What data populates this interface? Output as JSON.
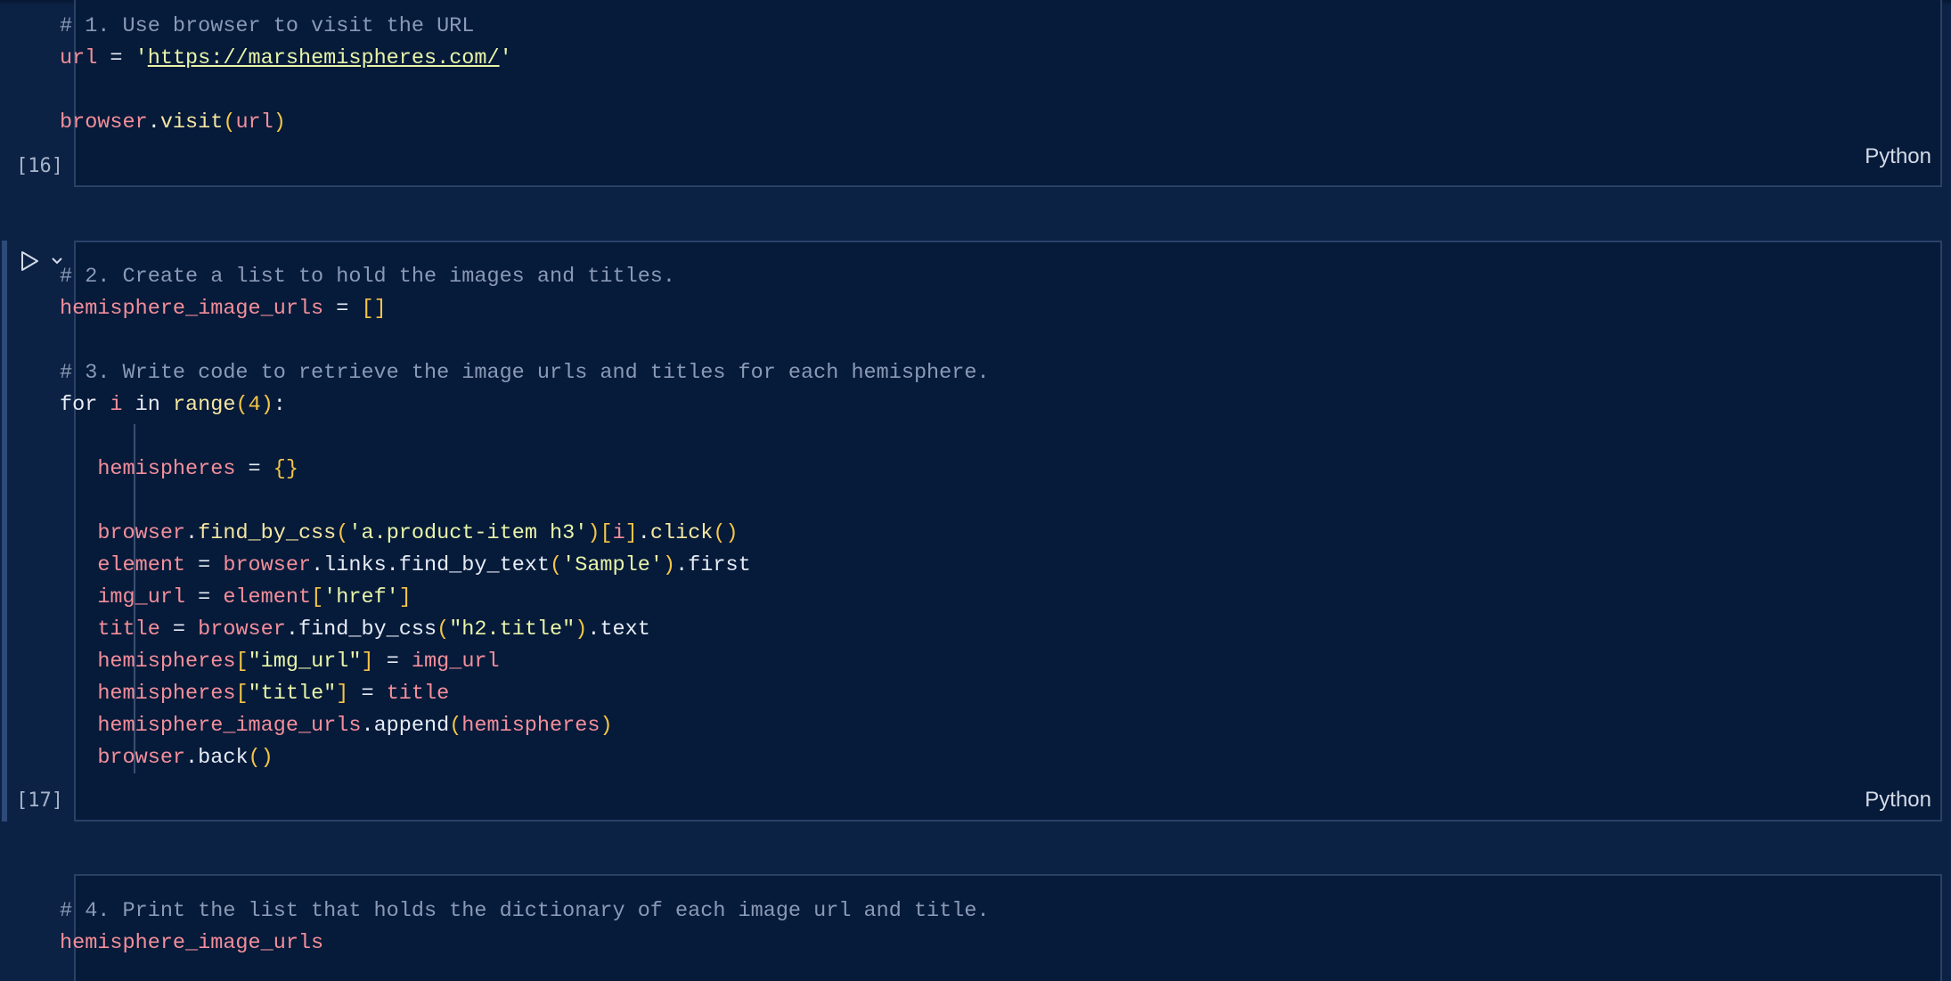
{
  "cells": [
    {
      "exec_count": "[16]",
      "language": "Python",
      "lines": {
        "l1": "# 1. Use browser to visit the URL",
        "l2_var": "url",
        "l2_eq": " = ",
        "l2_q1": "'",
        "l2_url": "https://marshemispheres.com/",
        "l2_q2": "'",
        "l4_obj": "browser",
        "l4_dot": ".",
        "l4_fn": "visit",
        "l4_open": "(",
        "l4_arg": "url",
        "l4_close": ")"
      }
    },
    {
      "exec_count": "[17]",
      "language": "Python",
      "lines": {
        "l1": "# 2. Create a list to hold the images and titles.",
        "l2_var": "hemisphere_image_urls",
        "l2_eq": " = ",
        "l2_br": "[]",
        "l4": "# 3. Write code to retrieve the image urls and titles for each hemisphere.",
        "l5_for": "for ",
        "l5_i": "i",
        "l5_in": " in ",
        "l5_range": "range",
        "l5_open": "(",
        "l5_num": "4",
        "l5_close": ")",
        "l5_colon": ":",
        "l7_var": "hemispheres",
        "l7_eq": " = ",
        "l7_br": "{}",
        "l9_obj": "browser",
        "l9_dot": ".",
        "l9_fn": "find_by_css",
        "l9_open": "(",
        "l9_str": "'a.product-item h3'",
        "l9_close": ")",
        "l9_idx_open": "[",
        "l9_idx": "i",
        "l9_idx_close": "]",
        "l9_dot2": ".",
        "l9_fn2": "click",
        "l9_call": "()",
        "l10_var": "element",
        "l10_eq": " = ",
        "l10_obj": "browser",
        "l10_rest1": ".links.find_by_text",
        "l10_open": "(",
        "l10_str": "'Sample'",
        "l10_close": ")",
        "l10_rest2": ".first",
        "l11_var": "img_url",
        "l11_eq": " = ",
        "l11_obj": "element",
        "l11_open": "[",
        "l11_str": "'href'",
        "l11_close": "]",
        "l12_var": "title",
        "l12_eq": " = ",
        "l12_obj": "browser",
        "l12_fn": ".find_by_css",
        "l12_open": "(",
        "l12_str": "\"h2.title\"",
        "l12_close": ")",
        "l12_rest": ".text",
        "l13_var": "hemispheres",
        "l13_open": "[",
        "l13_str": "\"img_url\"",
        "l13_close": "]",
        "l13_eq": " = ",
        "l13_val": "img_url",
        "l14_var": "hemispheres",
        "l14_open": "[",
        "l14_str": "\"title\"",
        "l14_close": "]",
        "l14_eq": " = ",
        "l14_val": "title",
        "l15_var": "hemisphere_image_urls",
        "l15_fn": ".append",
        "l15_open": "(",
        "l15_arg": "hemispheres",
        "l15_close": ")",
        "l16_obj": "browser",
        "l16_fn": ".back",
        "l16_call": "()"
      }
    },
    {
      "lines": {
        "l1": "# 4. Print the list that holds the dictionary of each image url and title.",
        "l2": "hemisphere_image_urls"
      }
    }
  ],
  "icons": {
    "run": "play-icon",
    "chevron": "chevron-down-icon"
  },
  "colors": {
    "background": "#0c2245",
    "cell_bg": "#061a3a",
    "comment": "#8a9ab5",
    "variable": "#f38f9a",
    "string": "#e8f5a8",
    "bracket": "#f3c646"
  }
}
